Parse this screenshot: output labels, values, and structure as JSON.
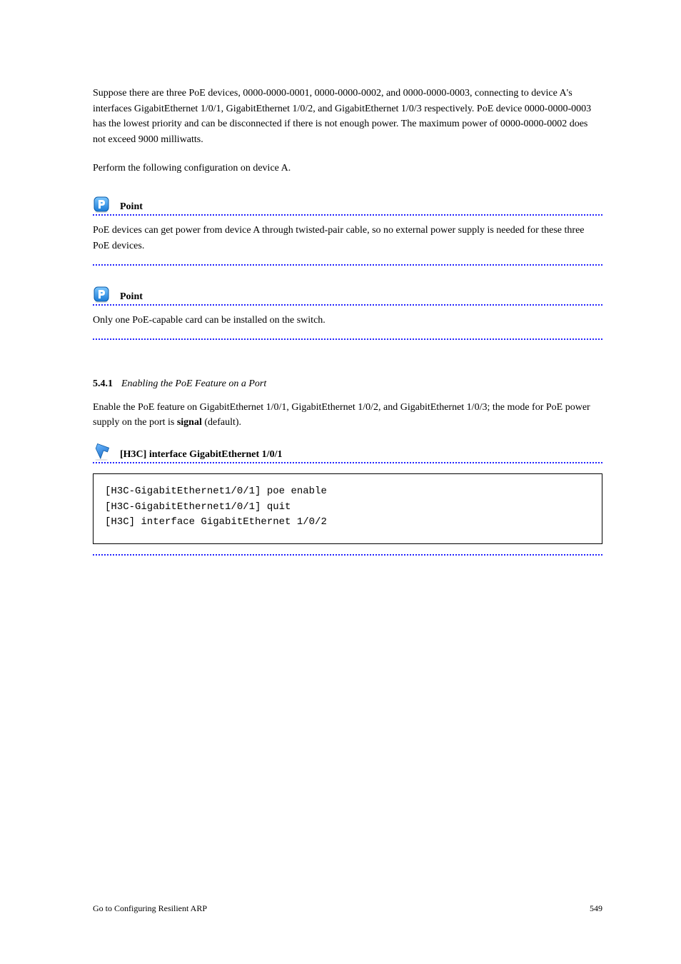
{
  "intro": {
    "text_1": "Suppose there are three PoE devices, 0000-0000-0001, 0000-0000-0002, and 0000-0000-0003, connecting to device A's interfaces GigabitEthernet 1/0/1, GigabitEthernet 1/0/2, and GigabitEthernet 1/0/3 respectively. PoE device 0000-0000-0003 has the lowest priority and can be disconnected if there is not enough power. The maximum power of 0000-0000-0002 does not exceed 9000 milliwatts.",
    "text_2": "Perform the following configuration on device A."
  },
  "point_1": {
    "title": "Point",
    "body": "PoE devices can get power from device A through twisted-pair cable, so no external power supply is needed for these three PoE devices."
  },
  "point_2": {
    "title": "Point",
    "body": "Only one PoE-capable card can be installed on the switch."
  },
  "task": {
    "number": "5.4.1",
    "title": "Enabling the PoE Feature on a Port",
    "intro": "Enable the PoE feature on GigabitEthernet 1/0/1, GigabitEthernet 1/0/2, and GigabitEthernet 1/0/3; the mode for PoE power supply on the port is ",
    "intro_bold": "signal",
    "intro_tail": " (default)."
  },
  "command": {
    "title": "[H3C] interface GigabitEthernet 1/0/1",
    "code": "[H3C-GigabitEthernet1/0/1] poe enable\n[H3C-GigabitEthernet1/0/1] quit\n[H3C] interface GigabitEthernet 1/0/2"
  },
  "footer": {
    "left": "Go to Configuring Resilient ARP",
    "right": "549"
  }
}
